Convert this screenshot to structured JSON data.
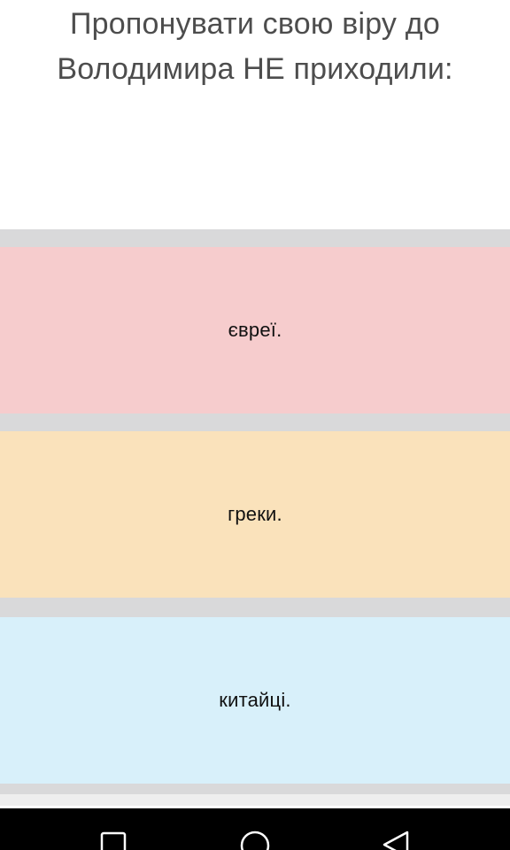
{
  "question": {
    "line1": "Пропонувати свою віру до",
    "line2": "Володимира НЕ приходили:"
  },
  "answers": [
    {
      "label": "євреї.",
      "color": "#f6cccd"
    },
    {
      "label": "греки.",
      "color": "#fae2bb"
    },
    {
      "label": "китайці.",
      "color": "#d8f0fa"
    }
  ],
  "navbar": {
    "icons": [
      "recent-apps-icon",
      "home-icon",
      "back-icon"
    ]
  }
}
